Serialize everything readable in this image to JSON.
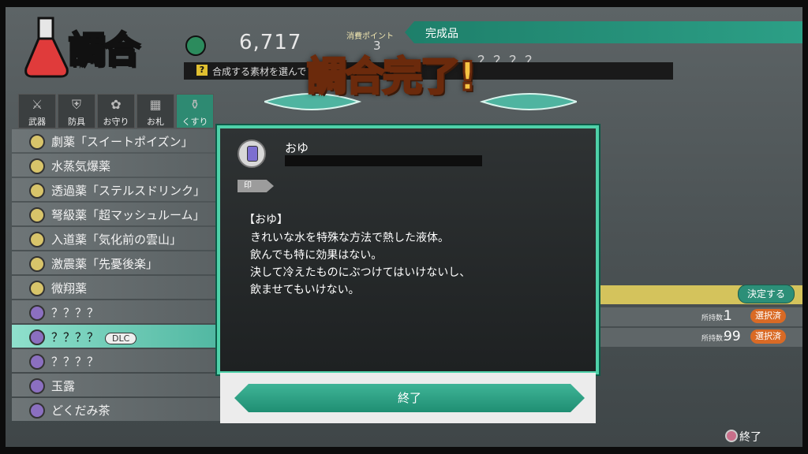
{
  "header": {
    "title": "調合",
    "money": "6,717",
    "cost_label": "消費ポイント",
    "cost_value": "3",
    "product_label": "完成品",
    "product_name": "？？？？",
    "hint_icon": "?",
    "hint": "合成する素材を選んで"
  },
  "tabs": [
    "武器",
    "防具",
    "お守り",
    "お札",
    "くすり"
  ],
  "list": [
    "劇薬「スイートポイズン」",
    "水蒸気爆薬",
    "透過薬「ステルスドリンク」",
    "弩級薬「超マッシュルーム」",
    "入道薬「気化前の雲山」",
    "激震薬「先憂後楽」",
    "微翔薬",
    "？？？？",
    "？？？？",
    "？？？？",
    "玉露",
    "どくだみ茶"
  ],
  "dlc_badge": "DLC",
  "right": {
    "confirm": "決定する",
    "owned_label": "所持数：",
    "materials": [
      {
        "count": "1",
        "status": "選択済"
      },
      {
        "count": "99",
        "status": "選択済"
      }
    ]
  },
  "footer": {
    "end": "終了"
  },
  "banner": "調合完了!",
  "dialog": {
    "item_name": "おゆ",
    "tag": "印",
    "desc_title": "【おゆ】",
    "desc": [
      "きれいな水を特殊な方法で熱した液体。",
      "飲んでも特に効果はない。",
      "決して冷えたものにぶつけてはいけないし、",
      "飲ませてもいけない。"
    ],
    "end_button": "終了"
  },
  "colors": {
    "accent": "#2c9f86",
    "frame": "#4fd1a9",
    "title_red": "#e23a3a",
    "banner_gold": "#f6c443"
  }
}
